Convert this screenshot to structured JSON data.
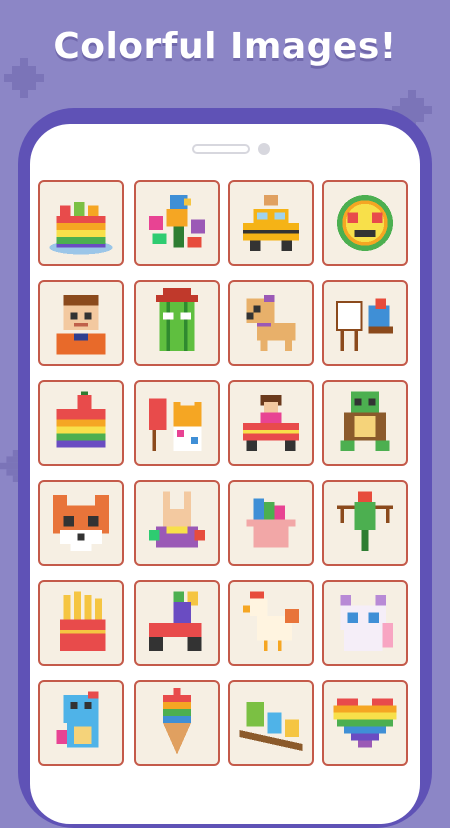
{
  "header": {
    "title": "Colorful Images!"
  },
  "colors": {
    "background": "#8c86c6",
    "phone_frame": "#5f52b6",
    "card_border": "#c45a4a",
    "card_fill": "#f6efe3"
  },
  "gallery": {
    "items": [
      {
        "name": "rainbow-cake-with-fruits"
      },
      {
        "name": "parrot-with-flowers"
      },
      {
        "name": "dog-driving-taxi"
      },
      {
        "name": "rainbow-heart-eyes-emoji"
      },
      {
        "name": "boy-portrait"
      },
      {
        "name": "cactus-with-hat"
      },
      {
        "name": "puppy-with-bow"
      },
      {
        "name": "bird-painting-easel"
      },
      {
        "name": "strawberry-rainbow-cake"
      },
      {
        "name": "cat-painter"
      },
      {
        "name": "girl-in-car"
      },
      {
        "name": "turtle"
      },
      {
        "name": "fox-face"
      },
      {
        "name": "colorful-rabbit"
      },
      {
        "name": "ice-cream-cup"
      },
      {
        "name": "parrot-on-branch"
      },
      {
        "name": "french-fries"
      },
      {
        "name": "scooter-rider"
      },
      {
        "name": "rooster"
      },
      {
        "name": "fluffy-cat"
      },
      {
        "name": "baby-dinosaur"
      },
      {
        "name": "rainbow-ice-cream-cone"
      },
      {
        "name": "birds-on-branch"
      },
      {
        "name": "rainbow-heart"
      }
    ]
  }
}
